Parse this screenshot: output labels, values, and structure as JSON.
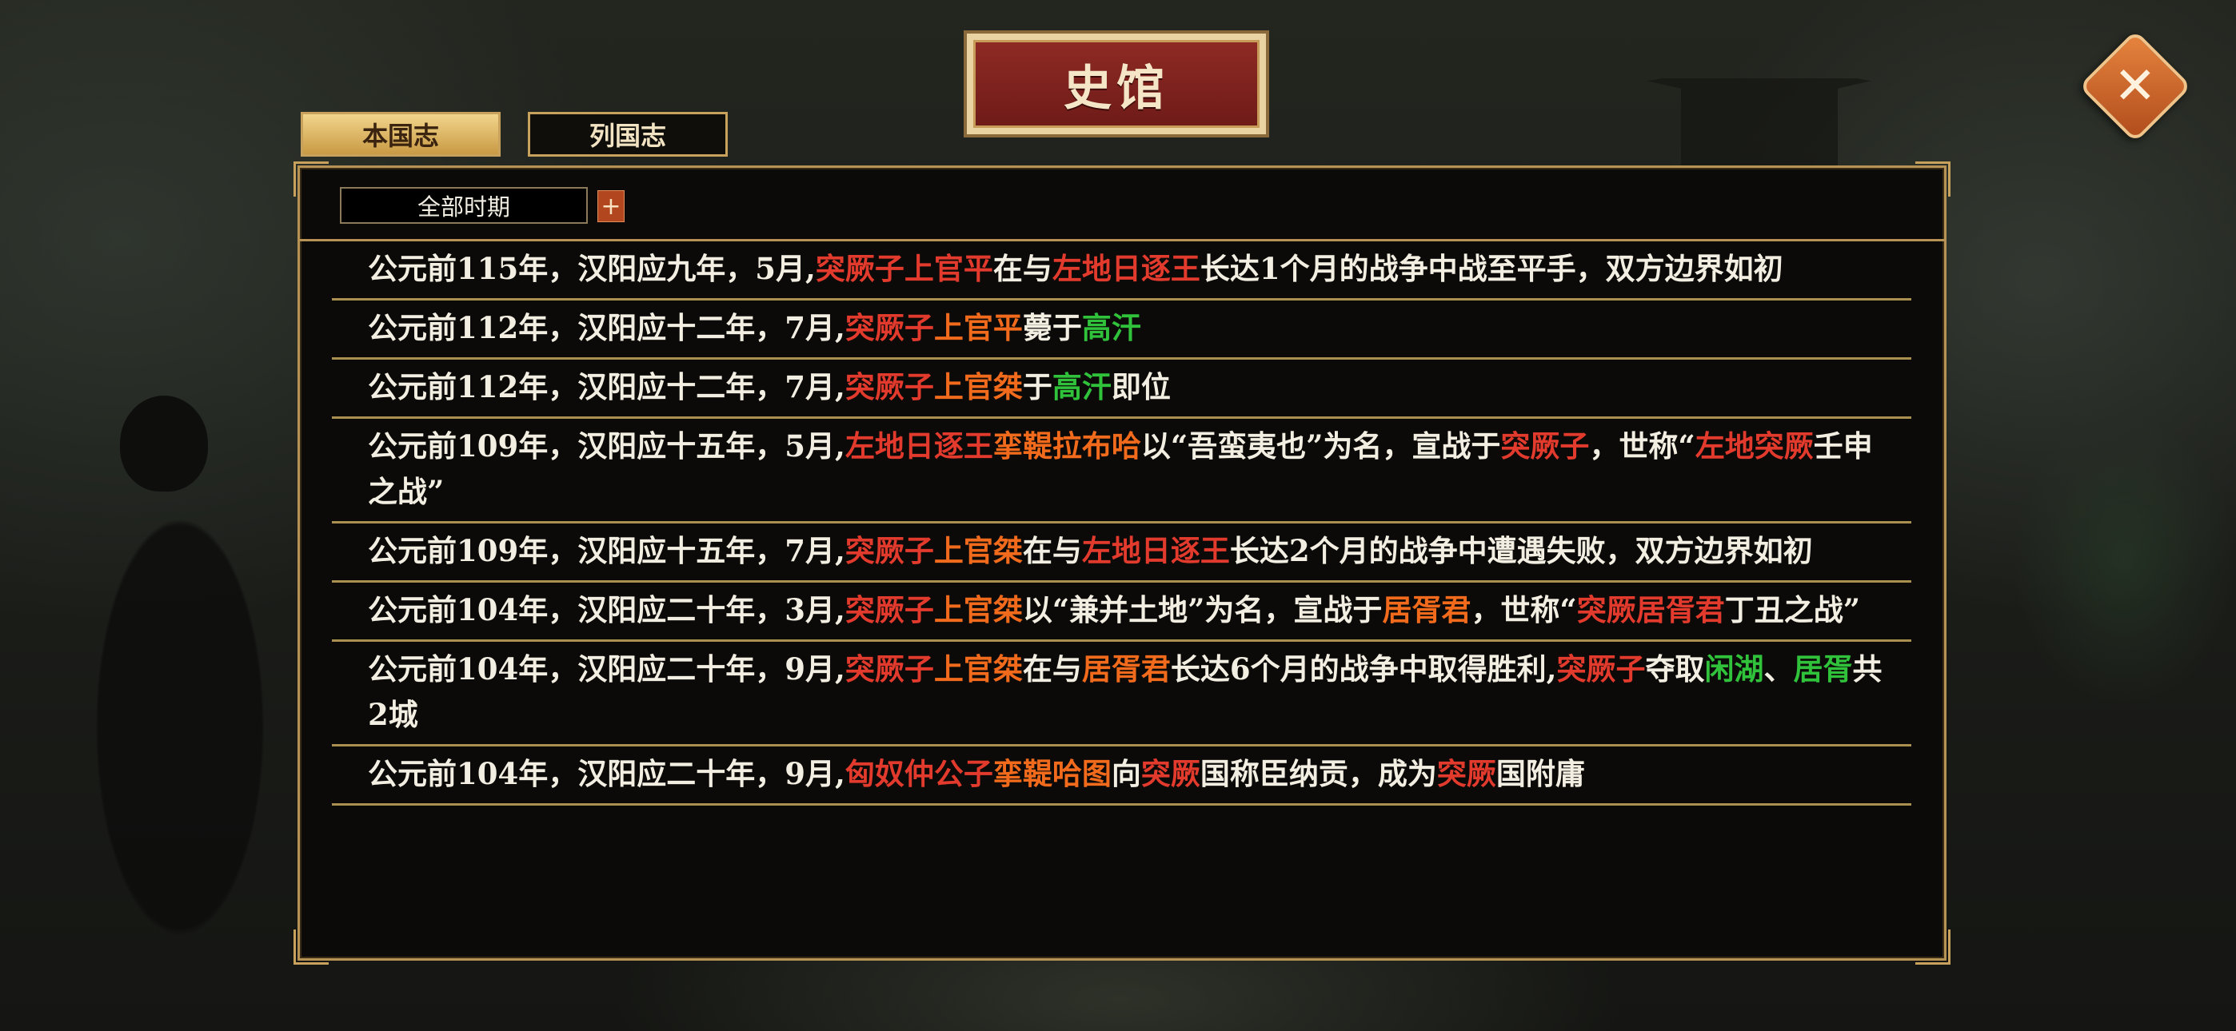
{
  "title": "史馆",
  "tabs": [
    {
      "label": "本国志",
      "active": true
    },
    {
      "label": "列国志",
      "active": false
    }
  ],
  "filter": {
    "period": "全部时期",
    "add_icon": "+"
  },
  "close_icon": "✕",
  "colors": {
    "country": "#e23a2c",
    "person": "#f26b1d",
    "place": "#31c23c"
  },
  "entries": [
    {
      "date": "公元前115年，汉阳应九年，5月,",
      "segments": [
        {
          "text": "突厥子上官平",
          "color": "red"
        },
        {
          "text": "在与",
          "color": "white"
        },
        {
          "text": "左地日逐王",
          "color": "red"
        },
        {
          "text": "长达1个月的战争中战至平手，双方边界如初",
          "color": "white"
        }
      ]
    },
    {
      "date": "公元前112年，汉阳应十二年，7月,",
      "segments": [
        {
          "text": "突厥子",
          "color": "red"
        },
        {
          "text": "上官平",
          "color": "orange"
        },
        {
          "text": "薨于",
          "color": "white"
        },
        {
          "text": "高汗",
          "color": "green"
        }
      ]
    },
    {
      "date": "公元前112年，汉阳应十二年，7月,",
      "segments": [
        {
          "text": "突厥子",
          "color": "red"
        },
        {
          "text": "上官桀",
          "color": "orange"
        },
        {
          "text": "于",
          "color": "white"
        },
        {
          "text": "高汗",
          "color": "green"
        },
        {
          "text": "即位",
          "color": "white"
        }
      ]
    },
    {
      "date": "公元前109年，汉阳应十五年，5月,",
      "segments": [
        {
          "text": "左地日逐王",
          "color": "red"
        },
        {
          "text": "挛鞮拉布哈",
          "color": "orange"
        },
        {
          "text": "以“吾蛮夷也”为名，宣战于",
          "color": "white"
        },
        {
          "text": "突厥子",
          "color": "red"
        },
        {
          "text": "，世称“",
          "color": "white"
        },
        {
          "text": "左地突厥",
          "color": "red"
        },
        {
          "text": "壬申之战”",
          "color": "white"
        }
      ]
    },
    {
      "date": "公元前109年，汉阳应十五年，7月,",
      "segments": [
        {
          "text": "突厥子",
          "color": "red"
        },
        {
          "text": "上官桀",
          "color": "orange"
        },
        {
          "text": "在与",
          "color": "white"
        },
        {
          "text": "左地日逐王",
          "color": "red"
        },
        {
          "text": "长达2个月的战争中遭遇失败，双方边界如初",
          "color": "white"
        }
      ]
    },
    {
      "date": "公元前104年，汉阳应二十年，3月,",
      "segments": [
        {
          "text": "突厥子",
          "color": "red"
        },
        {
          "text": "上官桀",
          "color": "orange"
        },
        {
          "text": "以“兼并土地”为名，宣战于",
          "color": "white"
        },
        {
          "text": "居胥君",
          "color": "orange"
        },
        {
          "text": "，世称“",
          "color": "white"
        },
        {
          "text": "突厥居胥君",
          "color": "red"
        },
        {
          "text": "丁丑之战”",
          "color": "white"
        }
      ]
    },
    {
      "date": "公元前104年，汉阳应二十年，9月,",
      "segments": [
        {
          "text": "突厥子",
          "color": "red"
        },
        {
          "text": "上官桀",
          "color": "orange"
        },
        {
          "text": "在与",
          "color": "white"
        },
        {
          "text": "居胥君",
          "color": "orange"
        },
        {
          "text": "长达6个月的战争中取得胜利,",
          "color": "white"
        },
        {
          "text": "突厥子",
          "color": "red"
        },
        {
          "text": "夺取",
          "color": "white"
        },
        {
          "text": "闲湖",
          "color": "green"
        },
        {
          "text": "、",
          "color": "white"
        },
        {
          "text": "居胥",
          "color": "green"
        },
        {
          "text": "共2城",
          "color": "white"
        }
      ]
    },
    {
      "date": "公元前104年，汉阳应二十年，9月,",
      "segments": [
        {
          "text": "匈奴仲公子",
          "color": "red"
        },
        {
          "text": "挛鞮哈图",
          "color": "orange"
        },
        {
          "text": "向",
          "color": "white"
        },
        {
          "text": "突厥",
          "color": "red"
        },
        {
          "text": "国称臣纳贡，成为",
          "color": "white"
        },
        {
          "text": "突厥",
          "color": "red"
        },
        {
          "text": "国附庸",
          "color": "white"
        }
      ]
    }
  ]
}
